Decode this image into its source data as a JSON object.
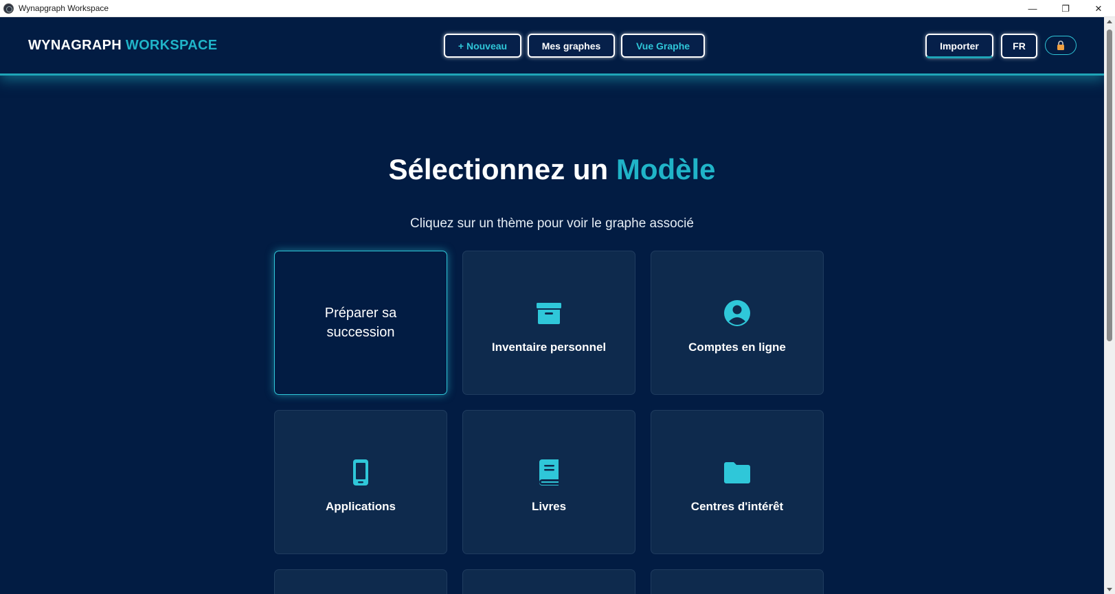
{
  "window": {
    "title": "Wynapgraph Workspace",
    "controls": {
      "minimize": "—",
      "restore": "❐",
      "close": "✕"
    }
  },
  "header": {
    "brand_main": "WYNAGRAPH",
    "brand_accent": "WORKSPACE",
    "nav": {
      "new_label": "+ Nouveau",
      "graphs_label": "Mes graphes",
      "view_label": "Vue Graphe"
    },
    "import_label": "Importer",
    "lang_label": "FR",
    "lock_icon": "lock-icon"
  },
  "main": {
    "title_main": "Sélectionnez un",
    "title_accent": "Modèle",
    "subtitle": "Cliquez sur un thème pour voir le graphe associé",
    "cards": [
      {
        "label": "Préparer sa succession",
        "icon": "none",
        "selected": true
      },
      {
        "label": "Inventaire personnel",
        "icon": "archive-box-icon"
      },
      {
        "label": "Comptes en ligne",
        "icon": "user-circle-icon"
      },
      {
        "label": "Applications",
        "icon": "smartphone-icon"
      },
      {
        "label": "Livres",
        "icon": "book-icon"
      },
      {
        "label": "Centres d'intérêt",
        "icon": "folder-icon"
      }
    ]
  },
  "colors": {
    "background": "#021c43",
    "accent": "#20b4c8",
    "card": "#0e2a4d",
    "icon": "#2fc7d9",
    "lock": "#f0a040"
  }
}
